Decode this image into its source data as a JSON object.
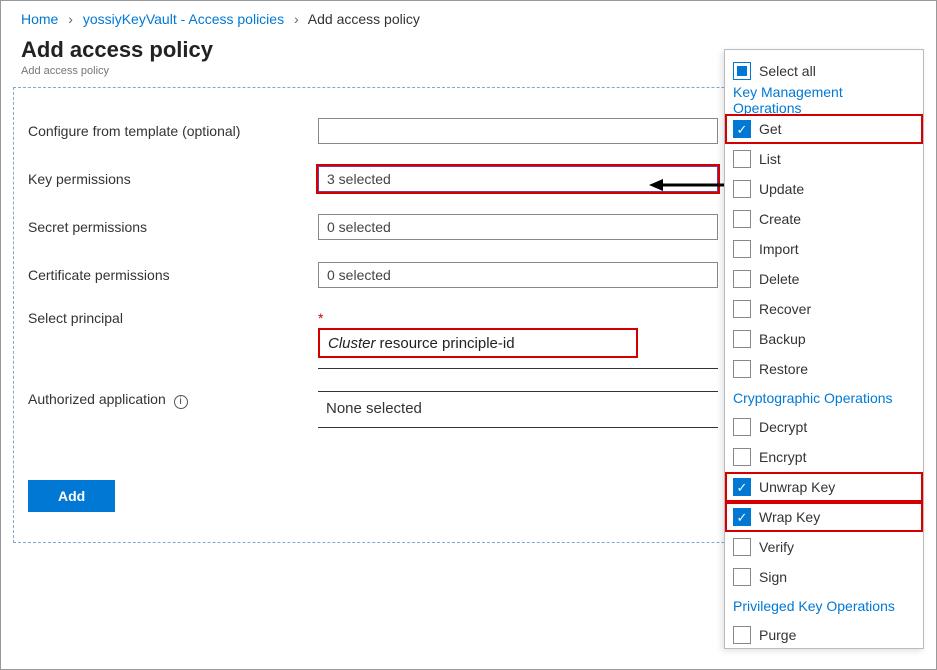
{
  "breadcrumb": {
    "home": "Home",
    "mid": "yossiyKeyVault - Access policies",
    "last": "Add access policy"
  },
  "header": {
    "title": "Add access policy",
    "subtitle": "Add access policy"
  },
  "form": {
    "template_label": "Configure from template (optional)",
    "key_perm_label": "Key permissions",
    "key_perm_value": "3 selected",
    "secret_perm_label": "Secret permissions",
    "secret_perm_value": "0 selected",
    "cert_perm_label": "Certificate permissions",
    "cert_perm_value": "0 selected",
    "principal_label": "Select principal",
    "principal_cluster": "Cluster",
    "principal_rest": "resource principle-id",
    "auth_app_label": "Authorized application",
    "none_selected": "None selected",
    "add_button": "Add"
  },
  "panel": {
    "select_all": "Select all",
    "groups": {
      "mgmt": "Key Management Operations",
      "crypto": "Cryptographic Operations",
      "priv": "Privileged Key Operations"
    },
    "opts": {
      "get": "Get",
      "list": "List",
      "update": "Update",
      "create": "Create",
      "import": "Import",
      "delete": "Delete",
      "recover": "Recover",
      "backup": "Backup",
      "restore": "Restore",
      "decrypt": "Decrypt",
      "encrypt": "Encrypt",
      "unwrap": "Unwrap Key",
      "wrap": "Wrap Key",
      "verify": "Verify",
      "sign": "Sign",
      "purge": "Purge"
    }
  }
}
